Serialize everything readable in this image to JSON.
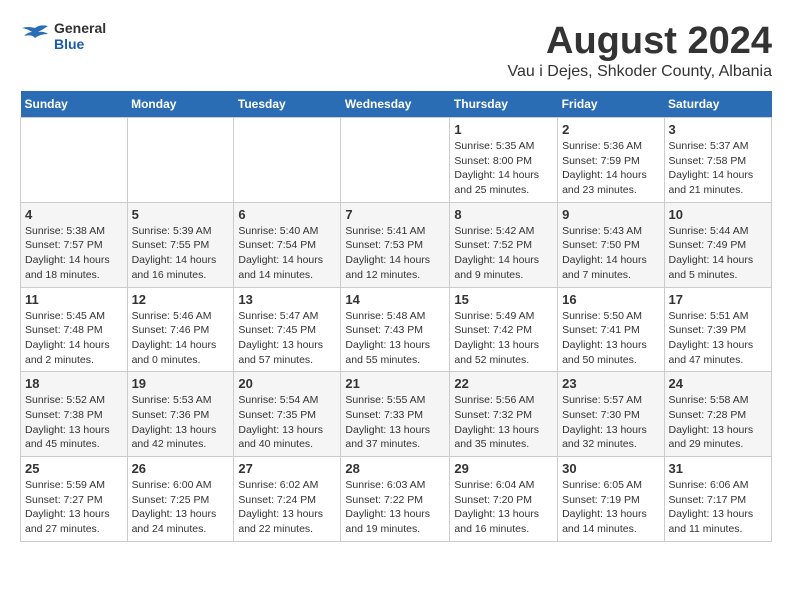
{
  "header": {
    "logo": {
      "general": "General",
      "blue": "Blue"
    },
    "title": "August 2024",
    "location": "Vau i Dejes, Shkoder County, Albania"
  },
  "weekdays": [
    "Sunday",
    "Monday",
    "Tuesday",
    "Wednesday",
    "Thursday",
    "Friday",
    "Saturday"
  ],
  "weeks": [
    [
      {
        "day": "",
        "info": ""
      },
      {
        "day": "",
        "info": ""
      },
      {
        "day": "",
        "info": ""
      },
      {
        "day": "",
        "info": ""
      },
      {
        "day": "1",
        "info": "Sunrise: 5:35 AM\nSunset: 8:00 PM\nDaylight: 14 hours\nand 25 minutes."
      },
      {
        "day": "2",
        "info": "Sunrise: 5:36 AM\nSunset: 7:59 PM\nDaylight: 14 hours\nand 23 minutes."
      },
      {
        "day": "3",
        "info": "Sunrise: 5:37 AM\nSunset: 7:58 PM\nDaylight: 14 hours\nand 21 minutes."
      }
    ],
    [
      {
        "day": "4",
        "info": "Sunrise: 5:38 AM\nSunset: 7:57 PM\nDaylight: 14 hours\nand 18 minutes."
      },
      {
        "day": "5",
        "info": "Sunrise: 5:39 AM\nSunset: 7:55 PM\nDaylight: 14 hours\nand 16 minutes."
      },
      {
        "day": "6",
        "info": "Sunrise: 5:40 AM\nSunset: 7:54 PM\nDaylight: 14 hours\nand 14 minutes."
      },
      {
        "day": "7",
        "info": "Sunrise: 5:41 AM\nSunset: 7:53 PM\nDaylight: 14 hours\nand 12 minutes."
      },
      {
        "day": "8",
        "info": "Sunrise: 5:42 AM\nSunset: 7:52 PM\nDaylight: 14 hours\nand 9 minutes."
      },
      {
        "day": "9",
        "info": "Sunrise: 5:43 AM\nSunset: 7:50 PM\nDaylight: 14 hours\nand 7 minutes."
      },
      {
        "day": "10",
        "info": "Sunrise: 5:44 AM\nSunset: 7:49 PM\nDaylight: 14 hours\nand 5 minutes."
      }
    ],
    [
      {
        "day": "11",
        "info": "Sunrise: 5:45 AM\nSunset: 7:48 PM\nDaylight: 14 hours\nand 2 minutes."
      },
      {
        "day": "12",
        "info": "Sunrise: 5:46 AM\nSunset: 7:46 PM\nDaylight: 14 hours\nand 0 minutes."
      },
      {
        "day": "13",
        "info": "Sunrise: 5:47 AM\nSunset: 7:45 PM\nDaylight: 13 hours\nand 57 minutes."
      },
      {
        "day": "14",
        "info": "Sunrise: 5:48 AM\nSunset: 7:43 PM\nDaylight: 13 hours\nand 55 minutes."
      },
      {
        "day": "15",
        "info": "Sunrise: 5:49 AM\nSunset: 7:42 PM\nDaylight: 13 hours\nand 52 minutes."
      },
      {
        "day": "16",
        "info": "Sunrise: 5:50 AM\nSunset: 7:41 PM\nDaylight: 13 hours\nand 50 minutes."
      },
      {
        "day": "17",
        "info": "Sunrise: 5:51 AM\nSunset: 7:39 PM\nDaylight: 13 hours\nand 47 minutes."
      }
    ],
    [
      {
        "day": "18",
        "info": "Sunrise: 5:52 AM\nSunset: 7:38 PM\nDaylight: 13 hours\nand 45 minutes."
      },
      {
        "day": "19",
        "info": "Sunrise: 5:53 AM\nSunset: 7:36 PM\nDaylight: 13 hours\nand 42 minutes."
      },
      {
        "day": "20",
        "info": "Sunrise: 5:54 AM\nSunset: 7:35 PM\nDaylight: 13 hours\nand 40 minutes."
      },
      {
        "day": "21",
        "info": "Sunrise: 5:55 AM\nSunset: 7:33 PM\nDaylight: 13 hours\nand 37 minutes."
      },
      {
        "day": "22",
        "info": "Sunrise: 5:56 AM\nSunset: 7:32 PM\nDaylight: 13 hours\nand 35 minutes."
      },
      {
        "day": "23",
        "info": "Sunrise: 5:57 AM\nSunset: 7:30 PM\nDaylight: 13 hours\nand 32 minutes."
      },
      {
        "day": "24",
        "info": "Sunrise: 5:58 AM\nSunset: 7:28 PM\nDaylight: 13 hours\nand 29 minutes."
      }
    ],
    [
      {
        "day": "25",
        "info": "Sunrise: 5:59 AM\nSunset: 7:27 PM\nDaylight: 13 hours\nand 27 minutes."
      },
      {
        "day": "26",
        "info": "Sunrise: 6:00 AM\nSunset: 7:25 PM\nDaylight: 13 hours\nand 24 minutes."
      },
      {
        "day": "27",
        "info": "Sunrise: 6:02 AM\nSunset: 7:24 PM\nDaylight: 13 hours\nand 22 minutes."
      },
      {
        "day": "28",
        "info": "Sunrise: 6:03 AM\nSunset: 7:22 PM\nDaylight: 13 hours\nand 19 minutes."
      },
      {
        "day": "29",
        "info": "Sunrise: 6:04 AM\nSunset: 7:20 PM\nDaylight: 13 hours\nand 16 minutes."
      },
      {
        "day": "30",
        "info": "Sunrise: 6:05 AM\nSunset: 7:19 PM\nDaylight: 13 hours\nand 14 minutes."
      },
      {
        "day": "31",
        "info": "Sunrise: 6:06 AM\nSunset: 7:17 PM\nDaylight: 13 hours\nand 11 minutes."
      }
    ]
  ]
}
